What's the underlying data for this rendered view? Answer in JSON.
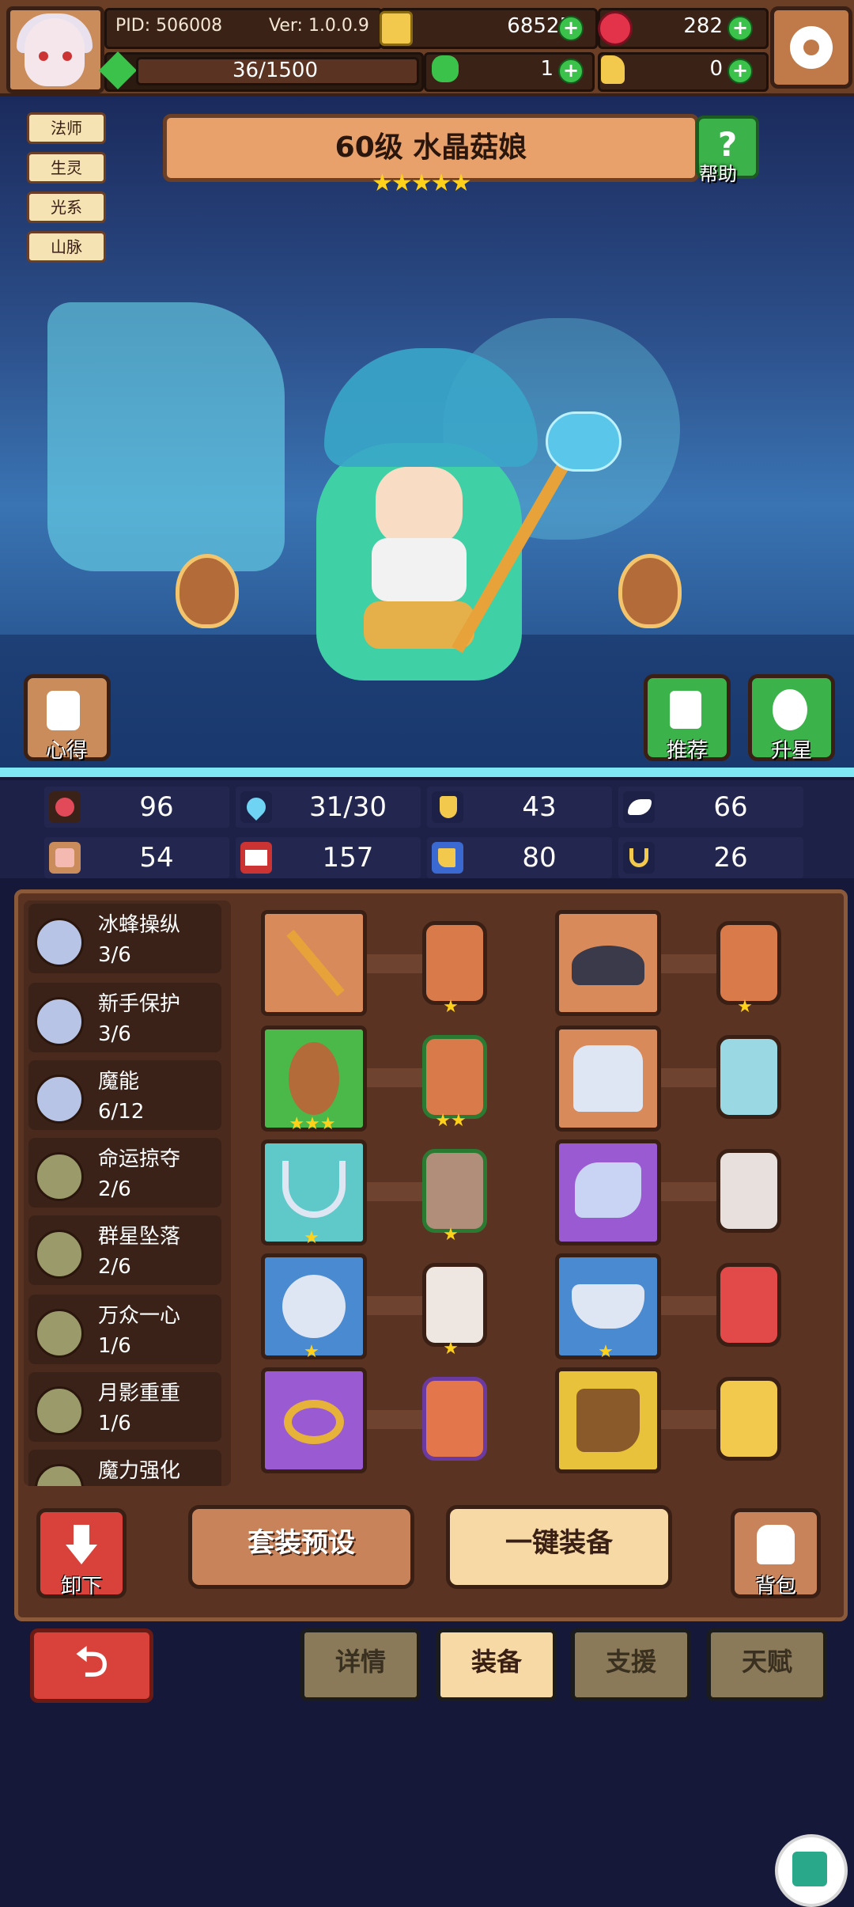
{
  "header": {
    "pid": "PID: 506008",
    "version": "Ver: 1.0.0.9",
    "gold": "68525",
    "gems": "282",
    "stamina": "36/1500",
    "clover": "1",
    "item": "0"
  },
  "character": {
    "tags": [
      "法师",
      "生灵",
      "光系",
      "山脉"
    ],
    "title": "60级 水晶菇娘",
    "stars": "★★★★★",
    "help_label": "帮助",
    "left_button": "心得",
    "recommend_button": "推荐",
    "star_up_button": "升星"
  },
  "stats": [
    "96",
    "31/30",
    "43",
    "66",
    "54",
    "157",
    "80",
    "26"
  ],
  "set_bonuses": [
    {
      "name": "冰蜂操纵",
      "count": "3/6"
    },
    {
      "name": "新手保护",
      "count": "3/6"
    },
    {
      "name": "魔能",
      "count": "6/12"
    },
    {
      "name": "命运掠夺",
      "count": "2/6"
    },
    {
      "name": "群星坠落",
      "count": "2/6"
    },
    {
      "name": "万众一心",
      "count": "1/6"
    },
    {
      "name": "月影重重",
      "count": "1/6"
    },
    {
      "name": "魔力强化",
      "count": ""
    }
  ],
  "actions": {
    "unequip": "卸下",
    "preset": "套装预设",
    "one_click": "一键装备",
    "bag": "背包"
  },
  "tabs": [
    "详情",
    "装备",
    "支援",
    "天赋"
  ],
  "colors": {
    "background": "#16183a",
    "wood": "#5a3322",
    "accent_gold": "#ffd11a",
    "green": "#3bc24a",
    "red": "#d9413b"
  }
}
